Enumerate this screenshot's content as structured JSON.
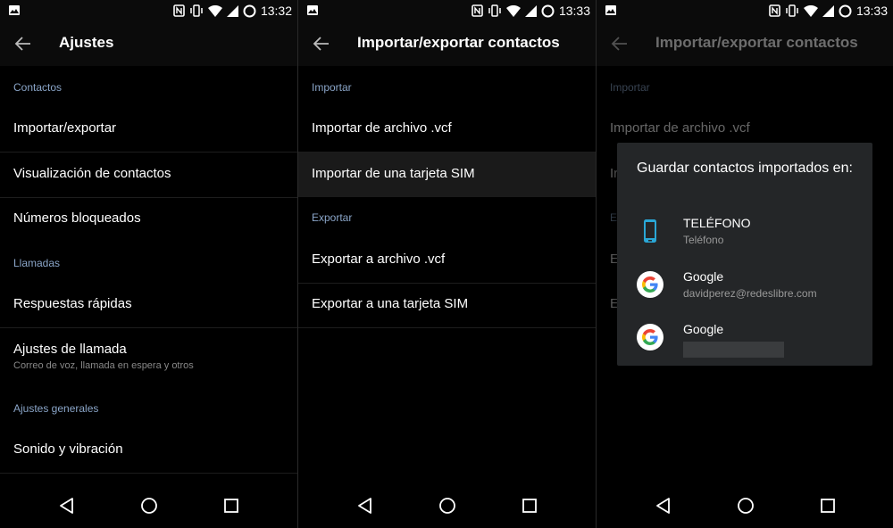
{
  "status": {
    "p1_time": "13:32",
    "p2_time": "13:33",
    "p3_time": "13:33"
  },
  "panel1": {
    "title": "Ajustes",
    "sections": {
      "contactos": "Contactos",
      "llamadas": "Llamadas",
      "generales": "Ajustes generales"
    },
    "items": {
      "importar": "Importar/exportar",
      "visualizacion": "Visualización de contactos",
      "bloqueados": "Números bloqueados",
      "respuestas": "Respuestas rápidas",
      "ajustes_llamada": "Ajustes de llamada",
      "ajustes_llamada_sub": "Correo de voz, llamada en espera y otros",
      "sonido": "Sonido y vibración"
    }
  },
  "panel2": {
    "title": "Importar/exportar contactos",
    "sections": {
      "importar": "Importar",
      "exportar": "Exportar"
    },
    "items": {
      "imp_vcf": "Importar de archivo .vcf",
      "imp_sim": "Importar de una tarjeta SIM",
      "exp_vcf": "Exportar a archivo .vcf",
      "exp_sim": "Exportar a una tarjeta SIM"
    }
  },
  "panel3": {
    "title": "Importar/exportar contactos",
    "section_importar": "Importar",
    "item_imp_vcf": "Importar de archivo .vcf",
    "partial": {
      "a": "Ir",
      "b": "Ex",
      "c": "E",
      "d": "E"
    },
    "dialog": {
      "title": "Guardar contactos importados en:",
      "accounts": [
        {
          "name": "TELÉFONO",
          "detail": "Teléfono",
          "icon": "phone-icon"
        },
        {
          "name": "Google",
          "detail": "davidperez@redeslibre.com",
          "icon": "google-icon"
        },
        {
          "name": "Google",
          "detail": "",
          "icon": "google-icon"
        }
      ]
    }
  },
  "colors": {
    "section_accent": "#8aa5c8",
    "phone_icon": "#2aa7d6"
  }
}
